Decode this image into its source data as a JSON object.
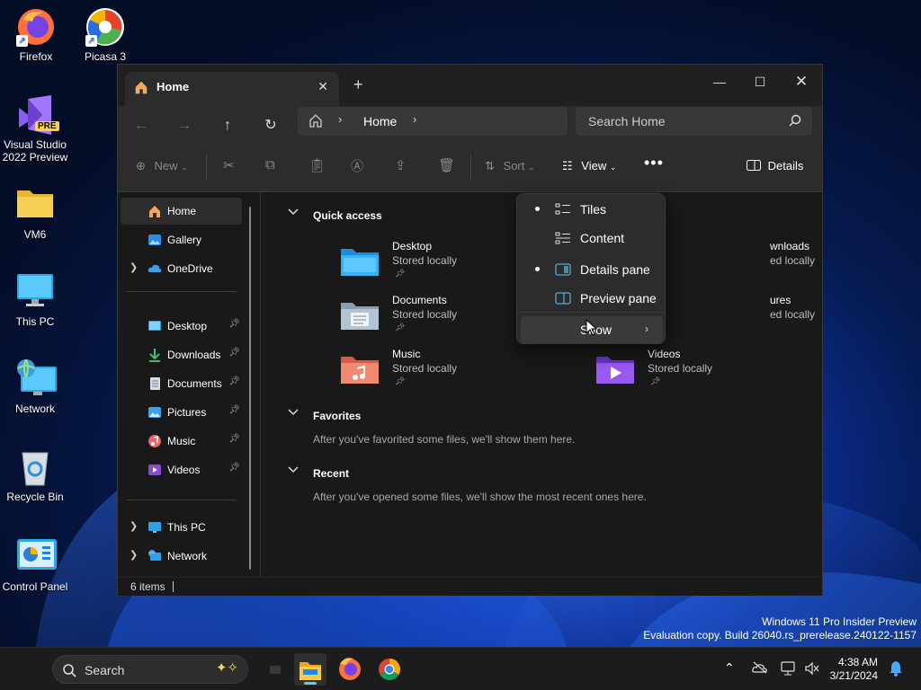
{
  "desktop": {
    "icons": [
      {
        "label": "Firefox"
      },
      {
        "label": "Picasa 3"
      },
      {
        "label": "Visual Studio\n2022 Preview",
        "line1": "Visual Studio",
        "line2": "2022 Preview",
        "badge": "PRE"
      },
      {
        "label": "VM6"
      },
      {
        "label": "This PC"
      },
      {
        "label": "Network"
      },
      {
        "label": "Recycle Bin"
      },
      {
        "label": "Control Panel"
      }
    ],
    "watermark": {
      "line1": "Windows 11 Pro Insider Preview",
      "line2": "Evaluation copy. Build 26040.rs_prerelease.240122-1157"
    }
  },
  "taskbar": {
    "search_label": "Search",
    "time": "4:38 AM",
    "date": "3/21/2024"
  },
  "explorer": {
    "tab_title": "Home",
    "address": {
      "location": "Home"
    },
    "search_placeholder": "Search Home",
    "commands": {
      "new": "New",
      "sort": "Sort",
      "view": "View",
      "details": "Details"
    },
    "nav": {
      "items": [
        {
          "label": "Home"
        },
        {
          "label": "Gallery"
        },
        {
          "label": "OneDrive"
        },
        {
          "label": "Desktop"
        },
        {
          "label": "Downloads"
        },
        {
          "label": "Documents"
        },
        {
          "label": "Pictures"
        },
        {
          "label": "Music"
        },
        {
          "label": "Videos"
        },
        {
          "label": "This PC"
        },
        {
          "label": "Network"
        }
      ]
    },
    "sections": {
      "quick_access": "Quick access",
      "favorites": "Favorites",
      "favorites_msg": "After you've favorited some files, we'll show them here.",
      "recent": "Recent",
      "recent_msg": "After you've opened some files, we'll show the most recent ones here."
    },
    "tiles": [
      {
        "name": "Desktop",
        "sub": "Stored locally"
      },
      {
        "name": "wnloads",
        "sub": "ed locally"
      },
      {
        "name": "Documents",
        "sub": "Stored locally"
      },
      {
        "name": "ures",
        "sub": "ed locally"
      },
      {
        "name": "Music",
        "sub": "Stored locally"
      },
      {
        "name": "Videos",
        "sub": "Stored locally"
      }
    ],
    "status": "6 items"
  },
  "view_menu": {
    "items": [
      {
        "label": "Tiles",
        "selected": true
      },
      {
        "label": "Content",
        "selected": false
      },
      {
        "label": "Details pane",
        "selected": true
      },
      {
        "label": "Preview pane",
        "selected": false
      },
      {
        "label": "Show",
        "submenu": true
      }
    ]
  },
  "colors": {
    "accent": "#60cdff",
    "folder": "#f4c84b",
    "window_bg": "#191919"
  }
}
